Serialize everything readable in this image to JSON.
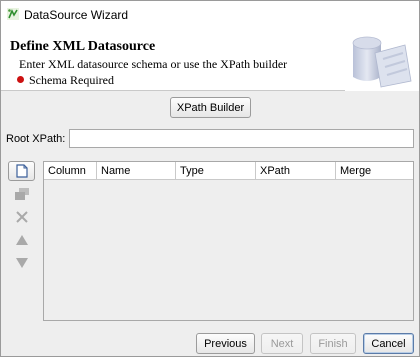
{
  "window": {
    "title": "DataSource Wizard"
  },
  "header": {
    "title": "Define XML Datasource",
    "subtitle": "Enter XML datasource schema or use the XPath builder",
    "status": {
      "text": "Schema Required",
      "color": "#cc1111"
    }
  },
  "toolbar": {
    "xpath_builder_label": "XPath Builder"
  },
  "root_xpath": {
    "label": "Root XPath:",
    "value": ""
  },
  "side_buttons": [
    {
      "icon": "new-document-icon",
      "enabled": true
    },
    {
      "icon": "duplicate-icon",
      "enabled": false
    },
    {
      "icon": "delete-icon",
      "enabled": false
    },
    {
      "icon": "move-up-icon",
      "enabled": false
    },
    {
      "icon": "move-down-icon",
      "enabled": false
    }
  ],
  "table": {
    "columns": [
      "Column",
      "Name",
      "Type",
      "XPath",
      "Merge"
    ],
    "rows": []
  },
  "footer": {
    "previous_label": "Previous",
    "next_label": "Next",
    "finish_label": "Finish",
    "cancel_label": "Cancel"
  }
}
